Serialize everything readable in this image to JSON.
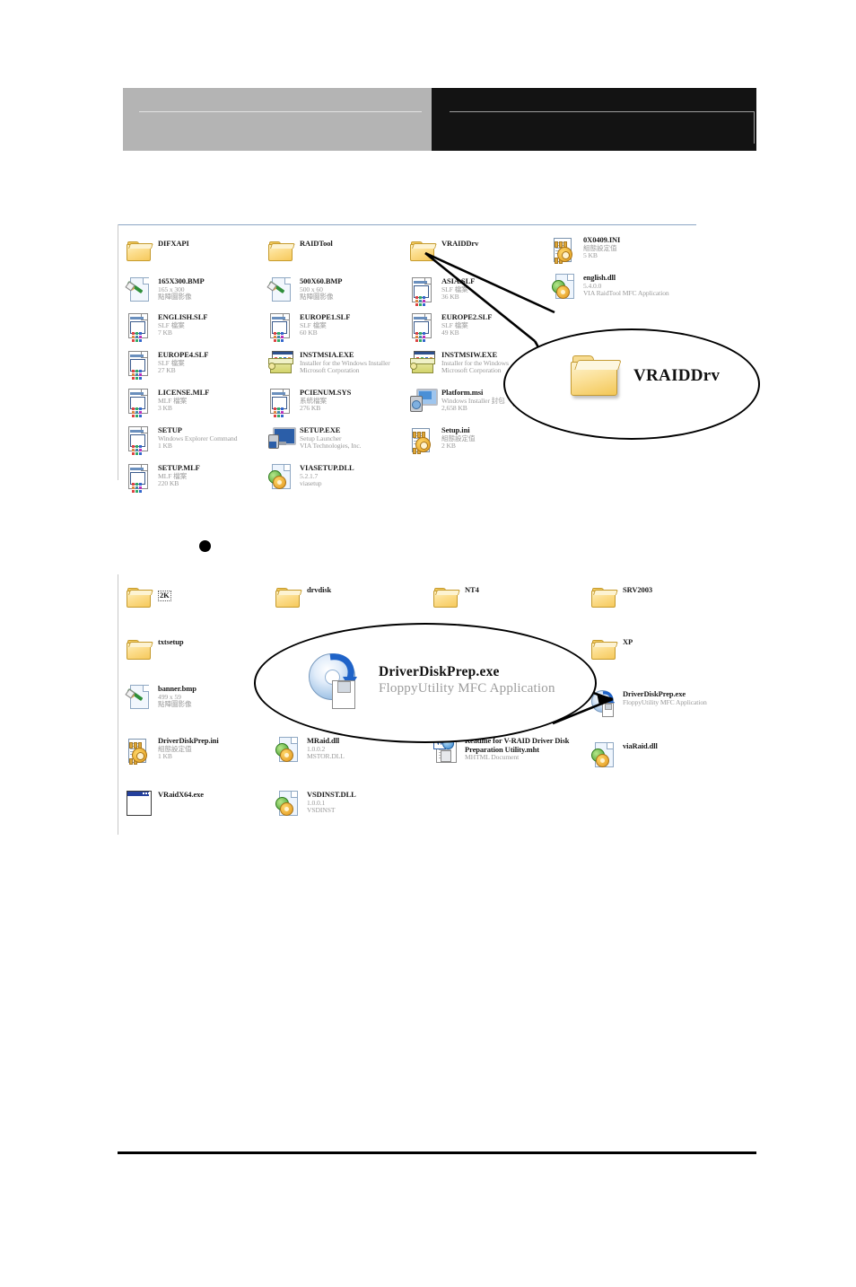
{
  "header": {
    "left_block_color": "#b4b4b4",
    "right_block_color": "#131313"
  },
  "bullet": {
    "glyph": "●"
  },
  "explorer_top": {
    "columns": [
      {
        "items": [
          {
            "icon": "folder-icon",
            "name": "DIFXAPI",
            "sub1": "",
            "sub2": ""
          },
          {
            "icon": "bitmap-image-icon",
            "name": "165X300.BMP",
            "sub1": "165 x 300",
            "sub2": "點陣圖影像"
          },
          {
            "icon": "slf-document-icon",
            "name": "ENGLISH.SLF",
            "sub1": "SLF 檔案",
            "sub2": "7 KB"
          },
          {
            "icon": "slf-document-icon",
            "name": "EUROPE4.SLF",
            "sub1": "SLF 檔案",
            "sub2": "27 KB"
          },
          {
            "icon": "mlf-document-icon",
            "name": "LICENSE.MLF",
            "sub1": "MLF 檔案",
            "sub2": "3 KB"
          },
          {
            "icon": "setup-command-icon",
            "name": "SETUP",
            "sub1": "Windows Explorer Command",
            "sub2": "1 KB"
          },
          {
            "icon": "mlf-document-icon",
            "name": "SETUP.MLF",
            "sub1": "MLF 檔案",
            "sub2": "220 KB"
          }
        ]
      },
      {
        "items": [
          {
            "icon": "folder-icon",
            "name": "RAIDTool",
            "sub1": "",
            "sub2": ""
          },
          {
            "icon": "bitmap-image-icon",
            "name": "500X60.BMP",
            "sub1": "500 x 60",
            "sub2": "點陣圖影像"
          },
          {
            "icon": "slf-document-icon",
            "name": "EUROPE1.SLF",
            "sub1": "SLF 檔案",
            "sub2": "60 KB"
          },
          {
            "icon": "installer-box-icon",
            "name": "INSTMSIA.EXE",
            "sub1": "Installer for the Windows Installer",
            "sub2": "Microsoft Corporation"
          },
          {
            "icon": "sys-document-icon",
            "name": "PCIENUM.SYS",
            "sub1": "系統檔案",
            "sub2": "276 KB"
          },
          {
            "icon": "setup-monitor-icon",
            "name": "SETUP.EXE",
            "sub1": "Setup Launcher",
            "sub2": "VIA Technologies, Inc."
          },
          {
            "icon": "dll-gear-icon",
            "name": "VIASETUP.DLL",
            "sub1": "5.2.1.7",
            "sub2": "viasetup"
          }
        ]
      },
      {
        "items": [
          {
            "icon": "folder-icon",
            "name": "VRAIDDrv",
            "sub1": "",
            "sub2": ""
          },
          {
            "icon": "slf-document-icon",
            "name": "ASIA.SLF",
            "sub1": "SLF 檔案",
            "sub2": "36 KB"
          },
          {
            "icon": "slf-document-icon",
            "name": "EUROPE2.SLF",
            "sub1": "SLF 檔案",
            "sub2": "49 KB"
          },
          {
            "icon": "installer-box-icon",
            "name": "INSTMSIW.EXE",
            "sub1": "Installer for the Windows",
            "sub2": "Microsoft Corporation"
          },
          {
            "icon": "msi-package-icon",
            "name": "Platform.msi",
            "sub1": "Windows Installer 封包",
            "sub2": "2,658 KB"
          },
          {
            "icon": "ini-notepad-icon",
            "name": "Setup.ini",
            "sub1": "組態設定值",
            "sub2": "2 KB"
          }
        ]
      },
      {
        "items": [
          {
            "icon": "ini-notepad-icon",
            "name": "0X0409.INI",
            "sub1": "組態設定值",
            "sub2": "5 KB"
          },
          {
            "icon": "dll-gear-icon",
            "name": "english.dll",
            "sub1": "5.4.0.0",
            "sub2": "VIA  RaidTool MFC Application"
          }
        ]
      }
    ]
  },
  "callout_top": {
    "icon": "folder-icon",
    "label": "VRAIDDrv"
  },
  "explorer_bottom": {
    "columns": [
      {
        "items": [
          {
            "icon": "folder-icon",
            "name": "2K",
            "sub1": "",
            "sub2": "",
            "selected": true
          },
          {
            "icon": "folder-icon",
            "name": "txtsetup",
            "sub1": "",
            "sub2": ""
          },
          {
            "icon": "bitmap-image-icon",
            "name": "banner.bmp",
            "sub1": "499 x 59",
            "sub2": "點陣圖影像"
          },
          {
            "icon": "ini-notepad-icon",
            "name": "DriverDiskPrep.ini",
            "sub1": "組態設定值",
            "sub2": "1 KB"
          },
          {
            "icon": "app-window-icon",
            "name": "VRaidX64.exe",
            "sub1": "",
            "sub2": ""
          }
        ]
      },
      {
        "items": [
          {
            "icon": "folder-icon",
            "name": "drvdisk",
            "sub1": "",
            "sub2": ""
          },
          {
            "icon": "dll-gear-icon",
            "name": "MRaid.dll",
            "sub1": "1.0.0.2",
            "sub2": "MSTOR.DLL"
          },
          {
            "icon": "dll-gear-icon",
            "name": "VSDINST.DLL",
            "sub1": "1.0.0.1",
            "sub2": "VSDINST"
          }
        ]
      },
      {
        "items": [
          {
            "icon": "folder-icon",
            "name": "NT4",
            "sub1": "",
            "sub2": ""
          },
          {
            "icon": "mhtml-document-icon",
            "name": "Readme for V-RAID Driver Disk",
            "name2": "Preparation Utility.mht",
            "sub1": "MHTML Document",
            "sub2": ""
          }
        ]
      },
      {
        "items": [
          {
            "icon": "folder-icon",
            "name": "SRV2003",
            "sub1": "",
            "sub2": ""
          },
          {
            "icon": "folder-icon",
            "name": "XP",
            "sub1": "",
            "sub2": ""
          },
          {
            "icon": "cd-floppy-icon",
            "name": "DriverDiskPrep.exe",
            "sub1": "FloppyUtility MFC Application",
            "sub2": ""
          },
          {
            "icon": "dll-gear-icon",
            "name": "viaRaid.dll",
            "sub1": "",
            "sub2": ""
          }
        ]
      }
    ]
  },
  "callout_bottom": {
    "icon": "cd-floppy-icon",
    "name": "DriverDiskPrep.exe",
    "sub": "FloppyUtility MFC Application"
  }
}
